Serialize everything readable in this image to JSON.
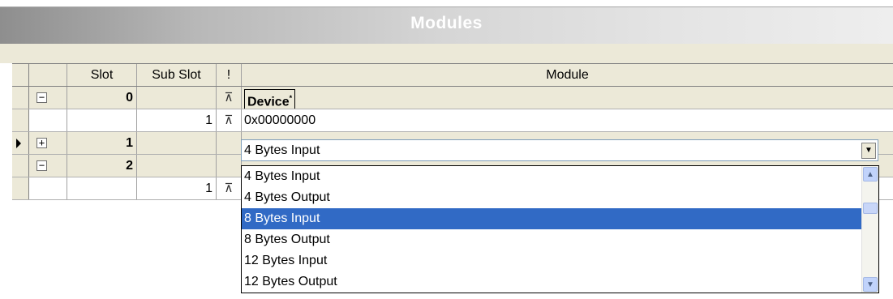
{
  "title": "Modules",
  "columns": {
    "slot": "Slot",
    "subslot": "Sub Slot",
    "flag": "!",
    "module": "Module"
  },
  "rows": [
    {
      "expander": "−",
      "slot": "0",
      "subslot": "",
      "pin": "⊼",
      "module": "Device",
      "module_mark": "*"
    },
    {
      "expander": "",
      "slot": "",
      "subslot": "1",
      "pin": "⊼",
      "module": "0x00000000"
    },
    {
      "expander": "+",
      "slot": "1",
      "subslot": "",
      "pin": "",
      "module": "4 Bytes Input"
    },
    {
      "expander": "−",
      "slot": "2",
      "subslot": "",
      "pin": "",
      "module": ""
    },
    {
      "expander": "",
      "slot": "",
      "subslot": "1",
      "pin": "⊼",
      "module": ""
    }
  ],
  "dropdown": {
    "selected_value": "4 Bytes Input",
    "options": [
      "4 Bytes Input",
      "4 Bytes Output",
      "8 Bytes Input",
      "8 Bytes Output",
      "12 Bytes Input",
      "12 Bytes Output"
    ],
    "highlighted_option": "8 Bytes Input"
  },
  "icons": {
    "row_pointer": "arrow-right-icon",
    "combo_button": "chevron-down-icon",
    "scroll_up": "arrow-up-icon",
    "scroll_down": "arrow-down-icon",
    "pin": "pin-icon"
  },
  "colors": {
    "highlight": "#316ac5",
    "grid_gray": "#ece9d8"
  }
}
